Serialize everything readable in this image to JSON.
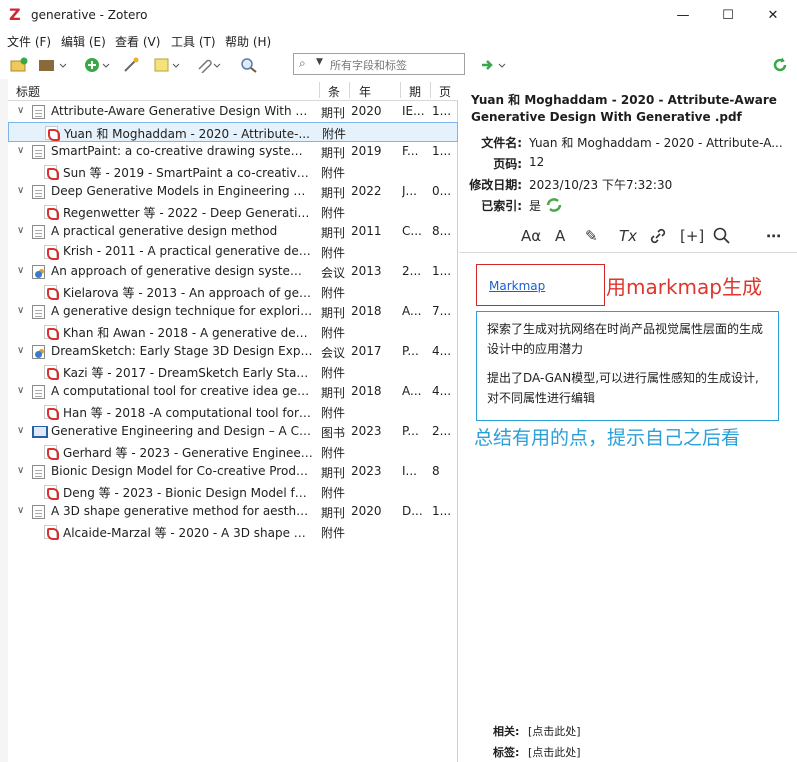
{
  "window": {
    "app_logo": "Z",
    "title": "generative - Zotero",
    "controls": {
      "minimize": "—",
      "maximize": "☐",
      "close": "✕"
    }
  },
  "menu": [
    {
      "label": "文件 (F)"
    },
    {
      "label": "编辑 (E)"
    },
    {
      "label": "查看 (V)"
    },
    {
      "label": "工具 (T)"
    },
    {
      "label": "帮助 (H)"
    }
  ],
  "search": {
    "placeholder": "所有字段和标签"
  },
  "columns": {
    "title": "标题",
    "type": "条",
    "year": "年",
    "pub": "期",
    "pages": "页"
  },
  "items": [
    {
      "icon": "journal",
      "expanded": true,
      "title": "Attribute-Aware Generative Design With G...",
      "type": "期刊",
      "year": "2020",
      "pub": "IE...",
      "pages": "1...",
      "child": {
        "title": "Yuan 和 Moghaddam - 2020 - Attribute-...",
        "type": "附件",
        "selected": true
      }
    },
    {
      "icon": "journal",
      "expanded": true,
      "title": "SmartPaint: a co-creative drawing system b...",
      "type": "期刊",
      "year": "2019",
      "pub": "F...",
      "pages": "1...",
      "child": {
        "title": "Sun 等 - 2019 - SmartPaint a co-creative ...",
        "type": "附件"
      }
    },
    {
      "icon": "journal",
      "expanded": true,
      "title": "Deep Generative Models in Engineering De...",
      "type": "期刊",
      "year": "2022",
      "pub": "J...",
      "pages": "0...",
      "child": {
        "title": "Regenwetter 等 - 2022 - Deep Generative...",
        "type": "附件"
      }
    },
    {
      "icon": "journal",
      "expanded": true,
      "title": "A practical generative design method",
      "type": "期刊",
      "year": "2011",
      "pub": "C...",
      "pages": "8...",
      "child": {
        "title": "Krish - 2011 - A practical generative desi...",
        "type": "附件"
      }
    },
    {
      "icon": "conference",
      "expanded": true,
      "title": "An approach of generative design system: J...",
      "type": "会议",
      "year": "2013",
      "pub": "2...",
      "pages": "1...",
      "child": {
        "title": "Kielarova 等 - 2013 - An approach of gen...",
        "type": "附件"
      }
    },
    {
      "icon": "journal",
      "expanded": true,
      "title": "A generative design technique for explorin...",
      "type": "期刊",
      "year": "2018",
      "pub": "A...",
      "pages": "7...",
      "child": {
        "title": "Khan 和 Awan - 2018 - A generative desi...",
        "type": "附件"
      }
    },
    {
      "icon": "conference",
      "expanded": true,
      "title": "DreamSketch: Early Stage 3D Design Explor...",
      "type": "会议",
      "year": "2017",
      "pub": "P...",
      "pages": "4...",
      "child": {
        "title": "Kazi 等 - 2017 - DreamSketch Early Stage ...",
        "type": "附件"
      }
    },
    {
      "icon": "journal",
      "expanded": true,
      "title": "A computational tool for creative idea gene...",
      "type": "期刊",
      "year": "2018",
      "pub": "A...",
      "pages": "4...",
      "child": {
        "title": "Han 等 - 2018 -A computational tool for ...",
        "type": "附件"
      }
    },
    {
      "icon": "book",
      "expanded": true,
      "title": "Generative Engineering and Design – A Co...",
      "type": "图书",
      "year": "2023",
      "pub": "P...",
      "pages": "2...",
      "child": {
        "title": "Gerhard 等 - 2023 - Generative Engineeri...",
        "type": "附件"
      }
    },
    {
      "icon": "journal",
      "expanded": true,
      "title": "Bionic Design Model for Co-creative Produ...",
      "type": "期刊",
      "year": "2023",
      "pub": "I...",
      "pages": "8",
      "child": {
        "title": "Deng 等 - 2023 - Bionic Design Model for...",
        "type": "附件"
      }
    },
    {
      "icon": "journal",
      "expanded": true,
      "title": "A 3D shape generative method for aestheti...",
      "type": "期刊",
      "year": "2020",
      "pub": "D...",
      "pages": "1...",
      "child": {
        "title": "Alcaide-Marzal 等 - 2020 - A 3D shape ge...",
        "type": "附件"
      }
    }
  ],
  "attachment": {
    "title": "Yuan 和 Moghaddam - 2020 - Attribute-Aware Generative Design With Generative .pdf",
    "filename_label": "文件名:",
    "filename": "Yuan 和 Moghaddam - 2020 - Attribute-A...",
    "pages_label": "页码:",
    "pages": "12",
    "modified_label": "修改日期:",
    "modified": "2023/10/23 下午7:32:30",
    "indexed_label": "已索引:",
    "indexed": "是"
  },
  "note_toolbar": {
    "font": "Aα",
    "size": "A",
    "highlight": "✎",
    "clear": "Tx",
    "link": "🔗",
    "cite": "[+]",
    "search": "⌕",
    "more": "⋯"
  },
  "note": {
    "link": "Markmap",
    "annotation_red": "用markmap生成",
    "paragraphs": [
      "探索了生成对抗网络在时尚产品视觉属性层面的生成设计中的应用潜力",
      "提出了DA-GAN模型,可以进行属性感知的生成设计,对不同属性进行编辑"
    ],
    "annotation_blue": "总结有用的点，提示自己之后看"
  },
  "footer": {
    "related_label": "相关:",
    "related_value": "[点击此处]",
    "tags_label": "标签:",
    "tags_value": "[点击此处]"
  },
  "colors": {
    "accent_red": "#e0352c",
    "accent_blue": "#2a9fd8",
    "selection": "#e5f1fb"
  }
}
